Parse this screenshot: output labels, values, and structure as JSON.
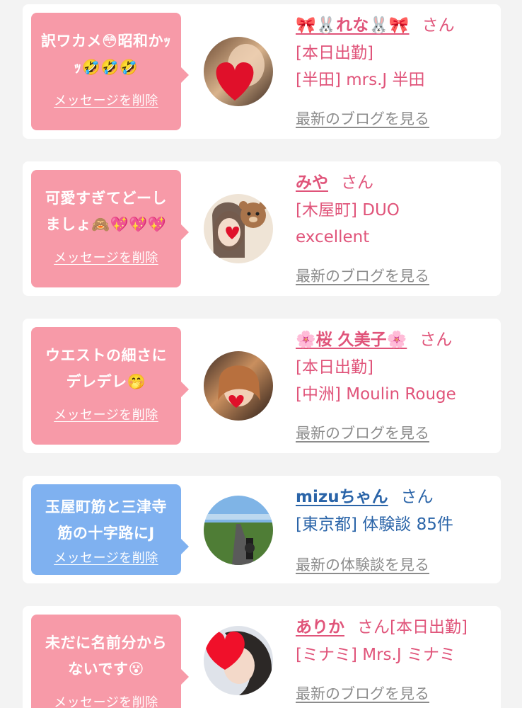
{
  "cards": [
    {
      "message": "訳ワカメ😳昭和かｯｯ🤣🤣🤣",
      "delete_label": "メッセージを削除",
      "name": "🎀🐰れな🐰🎀",
      "honorific": "さん",
      "lines": [
        "[本日出勤]",
        "[半田] mrs.J 半田"
      ],
      "more_label": "最新のブログを見る",
      "bubble_color": "#f79aa8",
      "avatar_icon": "heart-photo-icon"
    },
    {
      "message": "可愛すぎてどーしましょ🙈💖💖💖",
      "delete_label": "メッセージを削除",
      "name": "みや",
      "honorific": "さん",
      "lines": [
        "[木屋町] DUO",
        "excellent"
      ],
      "more_label": "最新のブログを見る",
      "bubble_color": "#f79aa8",
      "avatar_icon": "bear-sticker-photo-icon"
    },
    {
      "message": "ウエストの細さにデレデレ🤭",
      "delete_label": "メッセージを削除",
      "name": "🌸桜 久美子🌸",
      "honorific": "さん",
      "lines": [
        "[本日出勤]",
        "[中洲] Moulin Rouge"
      ],
      "more_label": "最新のブログを見る",
      "bubble_color": "#f79aa8",
      "avatar_icon": "heart-photo-icon"
    },
    {
      "message": "玉屋町筋と三津寺筋の十字路にJ",
      "delete_label": "メッセージを削除",
      "name": "mizuちゃん",
      "honorific": "さん",
      "lines": [
        "[東京都] 体験談 85件"
      ],
      "more_label": "最新の体験談を見る",
      "bubble_color": "#7fb1f0",
      "avatar_icon": "road-landscape-icon"
    },
    {
      "message": "未だに名前分からないです😵",
      "delete_label": "メッセージを削除",
      "name": "ありか",
      "honorific": "さん[本日出勤]",
      "lines": [
        "[ミナミ] Mrs.J ミナミ"
      ],
      "more_label": "最新のブログを見る",
      "bubble_color": "#f79aa8",
      "avatar_icon": "heart-photo-icon"
    }
  ],
  "colors": {
    "name_pink": "#e0547a",
    "name_blue": "#2a64a8",
    "link_gray": "#8c8c8c",
    "background": "#f3f3f3"
  }
}
